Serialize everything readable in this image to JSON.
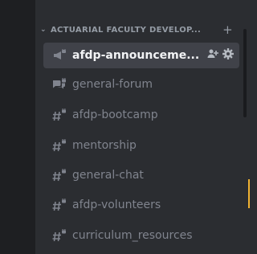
{
  "category": {
    "label": "ACTUARIAL FACULTY DEVELOP...",
    "collapse_icon": "chevron-down-icon",
    "add_icon": "plus-icon"
  },
  "channels": [
    {
      "label": "afdp-announceme...",
      "icon": "announcement-lock-icon",
      "selected": true
    },
    {
      "label": "general-forum",
      "icon": "forum-lock-icon",
      "selected": false
    },
    {
      "label": "afdp-bootcamp",
      "icon": "text-channel-lock-icon",
      "selected": false
    },
    {
      "label": "mentorship",
      "icon": "text-channel-lock-icon",
      "selected": false
    },
    {
      "label": "general-chat",
      "icon": "text-channel-lock-icon",
      "selected": false
    },
    {
      "label": "afdp-volunteers",
      "icon": "text-channel-lock-icon",
      "selected": false
    },
    {
      "label": "curriculum_resources",
      "icon": "text-channel-lock-icon",
      "selected": false
    }
  ],
  "colors": {
    "background": "#2b2d31",
    "selected_bg": "#404249",
    "muted_text": "#80848e",
    "selected_text": "#f2f3f5",
    "unread_indicator": "#f0b232"
  }
}
